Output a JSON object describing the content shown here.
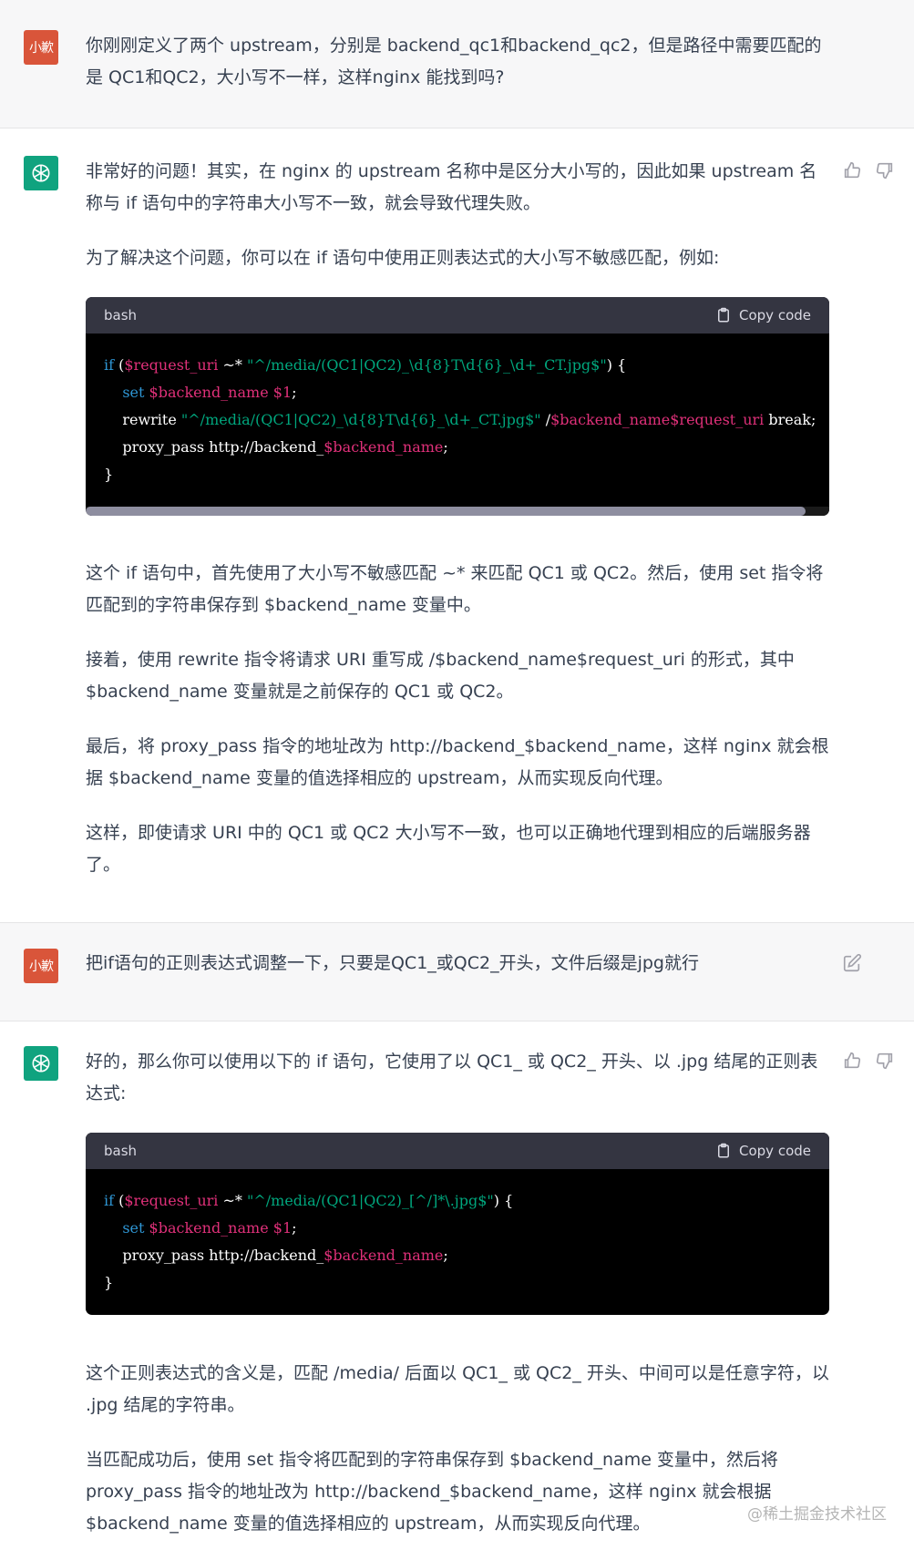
{
  "user_avatar_label": "小歉",
  "messages": [
    {
      "role": "user",
      "text": "你刚刚定义了两个 upstream，分别是 backend_qc1和backend_qc2，但是路径中需要匹配的是 QC1和QC2，大小写不一样，这样nginx 能找到吗?"
    },
    {
      "role": "assistant",
      "para1": "非常好的问题！其实，在 nginx 的 upstream 名称中是区分大小写的，因此如果 upstream 名称与 if 语句中的字符串大小写不一致，就会导致代理失败。",
      "para2": "为了解决这个问题，你可以在 if 语句中使用正则表达式的大小写不敏感匹配，例如:",
      "code": {
        "lang": "bash",
        "copy_label": "Copy code",
        "lines": [
          "if ($request_uri ~* \"^/media/(QC1|QC2)_\\d{8}T\\d{6}_\\d+_CT.jpg$\") {",
          "    set $backend_name $1;",
          "    rewrite \"^/media/(QC1|QC2)_\\d{8}T\\d{6}_\\d+_CT.jpg$\" /$backend_name$request_uri break;",
          "    proxy_pass http://backend_$backend_name;",
          "}"
        ]
      },
      "para3": "这个 if 语句中，首先使用了大小写不敏感匹配 ~* 来匹配 QC1 或 QC2。然后，使用 set 指令将匹配到的字符串保存到 $backend_name 变量中。",
      "para4": "接着，使用 rewrite 指令将请求 URI 重写成 /$backend_name$request_uri 的形式，其中 $backend_name 变量就是之前保存的 QC1 或 QC2。",
      "para5": "最后，将 proxy_pass 指令的地址改为 http://backend_$backend_name，这样 nginx 就会根据 $backend_name 变量的值选择相应的 upstream，从而实现反向代理。",
      "para6": "这样，即使请求 URI 中的 QC1 或 QC2 大小写不一致，也可以正确地代理到相应的后端服务器了。"
    },
    {
      "role": "user",
      "text": "把if语句的正则表达式调整一下，只要是QC1_或QC2_开头，文件后缀是jpg就行"
    },
    {
      "role": "assistant",
      "para1": "好的，那么你可以使用以下的 if 语句，它使用了以 QC1_ 或 QC2_ 开头、以 .jpg 结尾的正则表达式:",
      "code": {
        "lang": "bash",
        "copy_label": "Copy code",
        "lines": [
          "if ($request_uri ~* \"^/media/(QC1|QC2)_[^/]*\\.jpg$\") {",
          "    set $backend_name $1;",
          "    proxy_pass http://backend_$backend_name;",
          "}"
        ]
      },
      "para2": "这个正则表达式的含义是，匹配 /media/ 后面以 QC1_ 或 QC2_ 开头、中间可以是任意字符，以 .jpg 结尾的字符串。",
      "para3": "当匹配成功后，使用 set 指令将匹配到的字符串保存到 $backend_name 变量中，然后将 proxy_pass 指令的地址改为 http://backend_$backend_name，这样 nginx 就会根据 $backend_name 变量的值选择相应的 upstream，从而实现反向代理。"
    }
  ],
  "watermark": "@稀土掘金技术社区",
  "colors": {
    "user_bg": "#f7f7f8",
    "gpt_avatar": "#10a37f",
    "user_avatar": "#d9553a",
    "code_bg": "#000000"
  },
  "icons": [
    "chatgpt-logo-icon",
    "thumbs-up-icon",
    "thumbs-down-icon",
    "edit-icon",
    "clipboard-icon"
  ]
}
